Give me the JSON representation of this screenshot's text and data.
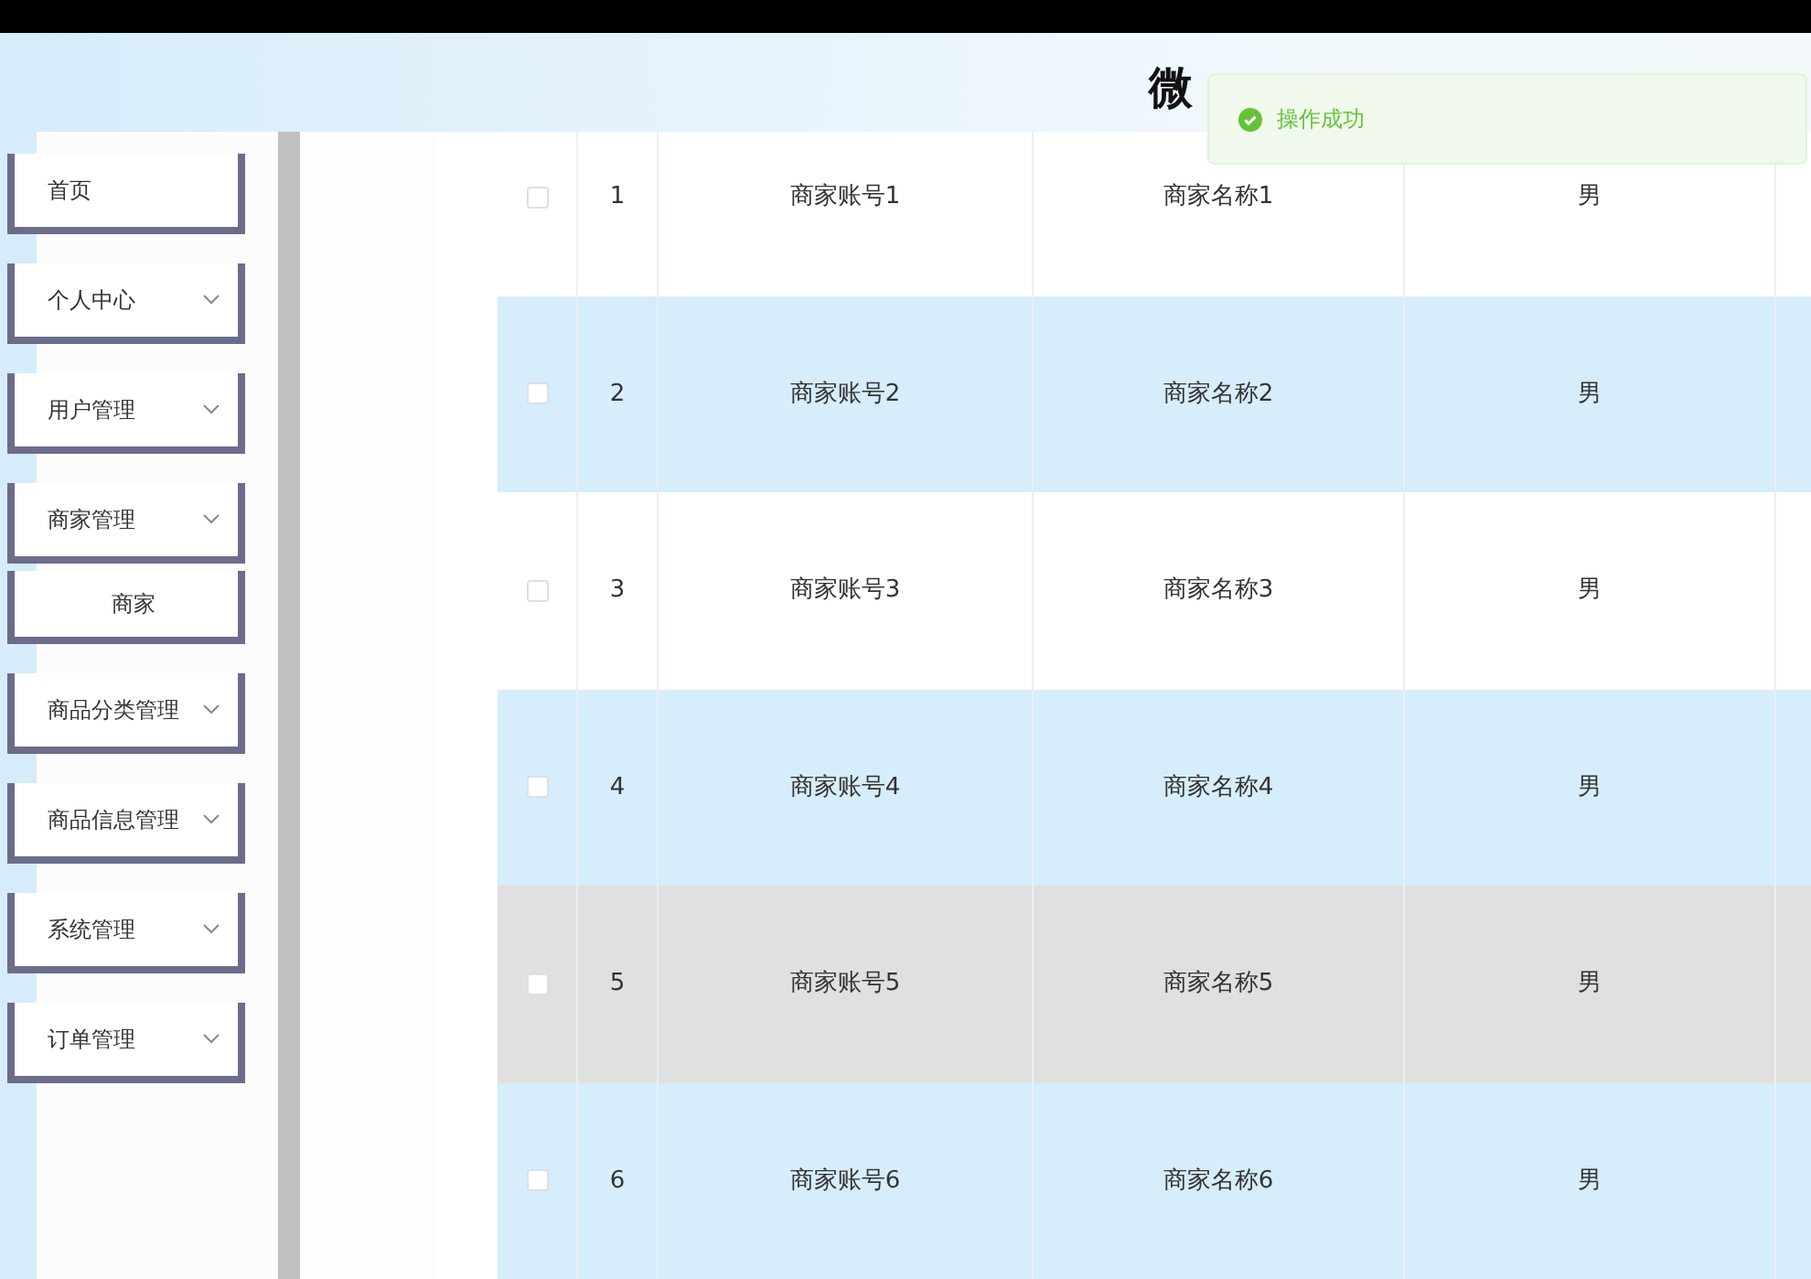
{
  "header": {
    "title": "微"
  },
  "toast": {
    "message": "操作成功"
  },
  "sidebar": {
    "items": [
      {
        "label": "首页",
        "kind": "link"
      },
      {
        "label": "个人中心",
        "kind": "menu"
      },
      {
        "label": "用户管理",
        "kind": "menu"
      },
      {
        "label": "商家管理",
        "kind": "menu"
      },
      {
        "label": "商家",
        "kind": "sub"
      },
      {
        "label": "商品分类管理",
        "kind": "menu"
      },
      {
        "label": "商品信息管理",
        "kind": "menu"
      },
      {
        "label": "系统管理",
        "kind": "menu"
      },
      {
        "label": "订单管理",
        "kind": "menu"
      }
    ]
  },
  "table": {
    "rows": [
      {
        "index": "1",
        "account": "商家账号1",
        "name": "商家名称1",
        "gender": "男",
        "checked": false,
        "hovered": false
      },
      {
        "index": "2",
        "account": "商家账号2",
        "name": "商家名称2",
        "gender": "男",
        "checked": false,
        "hovered": false
      },
      {
        "index": "3",
        "account": "商家账号3",
        "name": "商家名称3",
        "gender": "男",
        "checked": false,
        "hovered": false
      },
      {
        "index": "4",
        "account": "商家账号4",
        "name": "商家名称4",
        "gender": "男",
        "checked": false,
        "hovered": false
      },
      {
        "index": "5",
        "account": "商家账号5",
        "name": "商家名称5",
        "gender": "男",
        "checked": false,
        "hovered": true
      },
      {
        "index": "6",
        "account": "商家账号6",
        "name": "商家名称6",
        "gender": "男",
        "checked": false,
        "hovered": false
      }
    ]
  }
}
